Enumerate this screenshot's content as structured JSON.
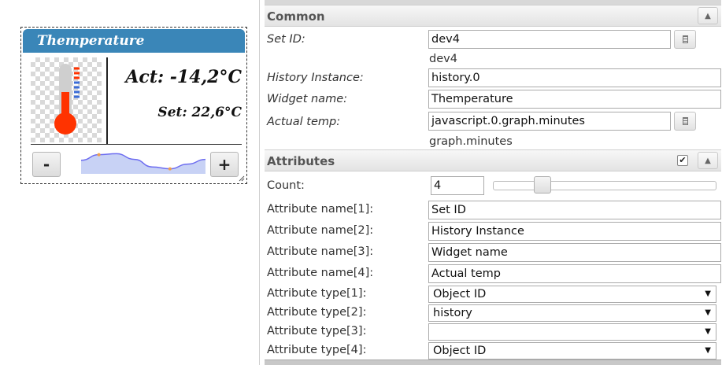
{
  "widget": {
    "title": "Themperature",
    "actual_text": "Act: -14,2°C",
    "set_text": "Set: 22,6°C",
    "minus_label": "-",
    "plus_label": "+",
    "sparkline": [
      0.55,
      0.85,
      0.9,
      0.6,
      0.2,
      0.1,
      0.35,
      0.6
    ]
  },
  "panel": {
    "common": {
      "title": "Common",
      "rows": {
        "set_id": {
          "label": "Set ID:",
          "value": "dev4",
          "sub": "dev4"
        },
        "history_instance": {
          "label": "History Instance:",
          "value": "history.0"
        },
        "widget_name": {
          "label": "Widget name:",
          "value": "Themperature"
        },
        "actual_temp": {
          "label": "Actual temp:",
          "value": "javascript.0.graph.minutes",
          "sub": "graph.minutes"
        }
      }
    },
    "attributes": {
      "title": "Attributes",
      "count_label": "Count:",
      "count_value": "4",
      "count_slider_fraction": 0.2,
      "names": [
        {
          "label": "Attribute name[1]:",
          "value": "Set ID"
        },
        {
          "label": "Attribute name[2]:",
          "value": "History Instance"
        },
        {
          "label": "Attribute name[3]:",
          "value": "Widget name"
        },
        {
          "label": "Attribute name[4]:",
          "value": "Actual temp"
        }
      ],
      "types": [
        {
          "label": "Attribute type[1]:",
          "value": "Object ID"
        },
        {
          "label": "Attribute type[2]:",
          "value": "history"
        },
        {
          "label": "Attribute type[3]:",
          "value": ""
        },
        {
          "label": "Attribute type[4]:",
          "value": "Object ID"
        }
      ]
    }
  },
  "colors": {
    "title_bar": "#3a86b8",
    "thermo_red": "#ff3300",
    "spark_line": "#6d6df0",
    "spark_fill": "#c8d2f5",
    "spark_dot": "#f0a050"
  }
}
